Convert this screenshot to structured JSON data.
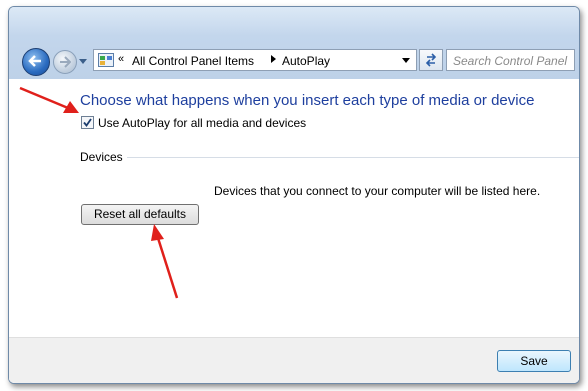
{
  "nav": {
    "breadcrumb": {
      "separator": "«",
      "items": [
        "All Control Panel Items",
        "AutoPlay"
      ]
    },
    "search_placeholder": "Search Control Panel"
  },
  "main": {
    "heading": "Choose what happens when you insert each type of media or device",
    "autoplay_checkbox": {
      "label": "Use AutoPlay for all media and devices",
      "checked": true
    },
    "devices": {
      "section_title": "Devices",
      "empty_message": "Devices that you connect to your computer will be listed here."
    },
    "reset_button": "Reset all defaults"
  },
  "footer": {
    "save_button": "Save"
  },
  "annotations": {
    "arrow_color": "#e0201b"
  }
}
